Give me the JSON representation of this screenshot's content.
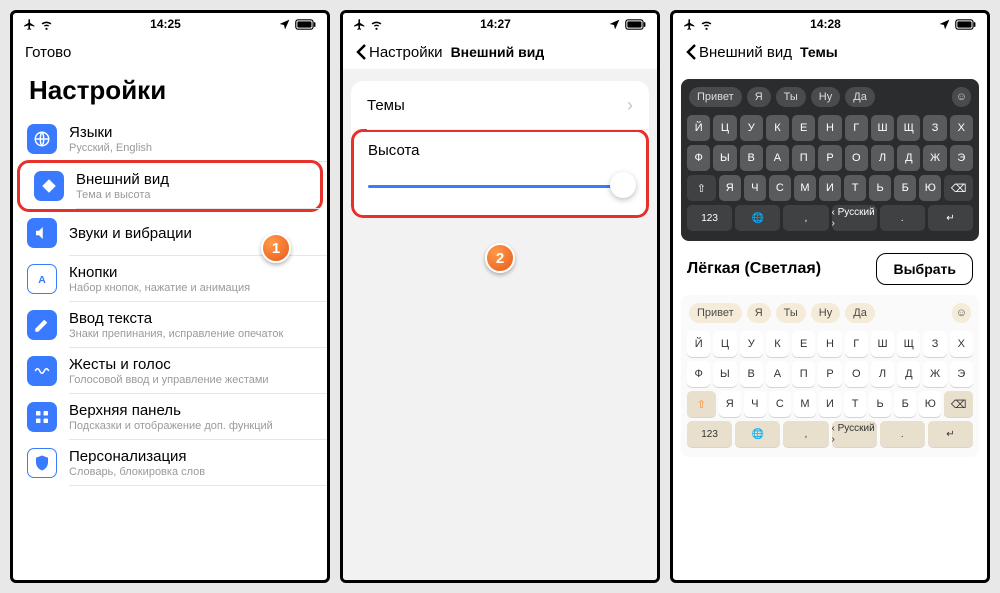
{
  "status": {
    "times": [
      "14:25",
      "14:27",
      "14:28"
    ]
  },
  "p1": {
    "done": "Готово",
    "title": "Настройки",
    "items": [
      {
        "t": "Языки",
        "s": "Русский, English",
        "icon": "globe",
        "c": "#3a7afe"
      },
      {
        "t": "Внешний вид",
        "s": "Тема и высота",
        "icon": "diamond",
        "c": "#3a7afe"
      },
      {
        "t": "Звуки и вибрации",
        "s": "",
        "icon": "speaker",
        "c": "#3a7afe"
      },
      {
        "t": "Кнопки",
        "s": "Набор кнопок, нажатие и анимация",
        "icon": "aletter",
        "c": "#3a7afe"
      },
      {
        "t": "Ввод текста",
        "s": "Знаки препинания, исправление опечаток",
        "icon": "pencil",
        "c": "#3a7afe"
      },
      {
        "t": "Жесты и голос",
        "s": "Голосовой ввод и управление жестами",
        "icon": "wave",
        "c": "#3a7afe"
      },
      {
        "t": "Верхняя панель",
        "s": "Подсказки и отображение доп. функций",
        "icon": "grid",
        "c": "#3a7afe"
      },
      {
        "t": "Персонализация",
        "s": "Словарь, блокировка слов",
        "icon": "shield",
        "c": "#3a7afe"
      }
    ],
    "badge": "1"
  },
  "p2": {
    "back": "Настройки",
    "title": "Внешний вид",
    "themes": "Темы",
    "height": "Высота",
    "badge": "2"
  },
  "p3": {
    "back": "Внешний вид",
    "title": "Темы",
    "sugg": [
      "Привет",
      "Я",
      "Ты",
      "Ну",
      "Да"
    ],
    "row1": [
      "Й",
      "Ц",
      "У",
      "К",
      "Е",
      "Н",
      "Г",
      "Ш",
      "Щ",
      "З",
      "Х"
    ],
    "row2": [
      "Ф",
      "Ы",
      "В",
      "А",
      "П",
      "Р",
      "О",
      "Л",
      "Д",
      "Ж",
      "Э"
    ],
    "row3": [
      "Я",
      "Ч",
      "С",
      "М",
      "И",
      "Т",
      "Ь",
      "Б",
      "Ю"
    ],
    "bot": {
      "num": "123",
      "globe": "🌐",
      "comma": ",",
      "space": "‹ Русский ›",
      "dot": ".",
      "ret": "↵"
    },
    "shift": "⇧",
    "bksp": "⌫",
    "theme_name": "Лёгкая (Светлая)",
    "select": "Выбрать"
  }
}
